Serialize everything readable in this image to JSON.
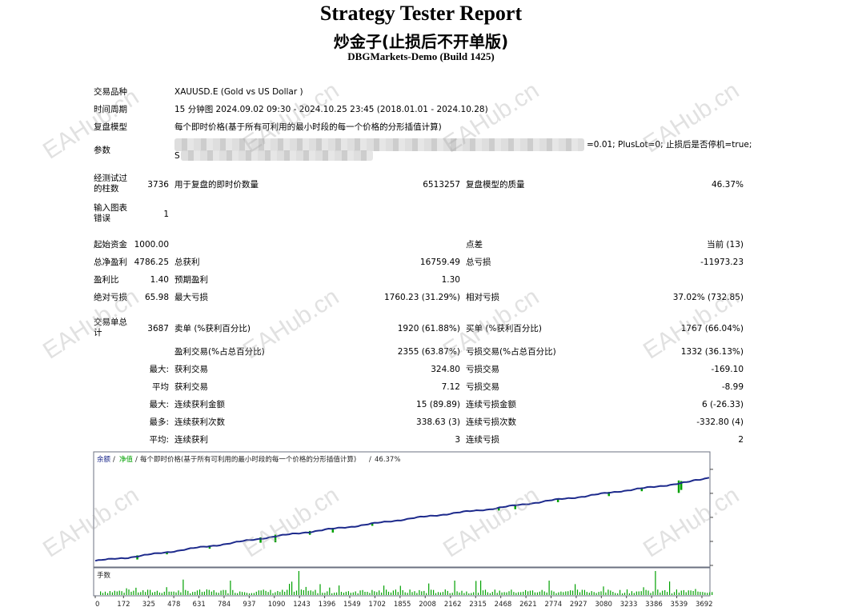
{
  "header": {
    "title": "Strategy Tester Report",
    "ea_name": "炒金子(止损后不开单版)",
    "server": "DBGMarkets-Demo (Build 1425)"
  },
  "settings": {
    "symbol_label": "交易品种",
    "symbol_value": "XAUUSD.E (Gold vs US Dollar )",
    "period_label": "时间周期",
    "period_value": "15 分钟图 2024.09.02 09:30 - 2024.10.25 23:45 (2018.01.01 - 2024.10.28)",
    "model_label": "复盘模型",
    "model_value": "每个即时价格(基于所有可利用的最小时段的每一个价格的分形插值计算)",
    "params_label": "参数",
    "params_visible_1": "=0.01; PlusLot=0; 止损后是否停机=true;",
    "params_visible_2": "S"
  },
  "stats": {
    "bars_label": "经测试过的柱数",
    "bars_value": "3736",
    "ticks_label": "用于复盘的即时价数量",
    "ticks_value": "6513257",
    "quality_label": "复盘模型的质量",
    "quality_value": "46.37%",
    "errors_label": "输入图表错误",
    "errors_value": "1",
    "deposit_label": "起始资金",
    "deposit_value": "1000.00",
    "spread_label": "点差",
    "spread_value": "当前 (13)",
    "net_label": "总净盈利",
    "net_value": "4786.25",
    "gross_profit_label": "总获利",
    "gross_profit_value": "16759.49",
    "gross_loss_label": "总亏损",
    "gross_loss_value": "-11973.23",
    "pf_label": "盈利比",
    "pf_value": "1.40",
    "payoff_label": "预期盈利",
    "payoff_value": "1.30",
    "abs_dd_label": "绝对亏损",
    "abs_dd_value": "65.98",
    "max_dd_label": "最大亏损",
    "max_dd_value": "1760.23 (31.29%)",
    "rel_dd_label": "相对亏损",
    "rel_dd_value": "37.02% (732.85)",
    "trades_label": "交易单总计",
    "trades_value": "3687",
    "short_label": "卖单 (%获利百分比)",
    "short_value": "1920 (61.88%)",
    "long_label": "买单 (%获利百分比)",
    "long_value": "1767 (66.04%)",
    "profit_trades_label": "盈利交易(%占总百分比)",
    "profit_trades_value": "2355 (63.87%)",
    "loss_trades_label": "亏损交易(%占总百分比)",
    "loss_trades_value": "1332 (36.13%)",
    "largest_label": "最大:",
    "largest_profit_label": "获利交易",
    "largest_profit_value": "324.80",
    "largest_loss_label": "亏损交易",
    "largest_loss_value": "-169.10",
    "average_label": "平均",
    "average_profit_label": "获利交易",
    "average_profit_value": "7.12",
    "average_loss_label": "亏损交易",
    "average_loss_value": "-8.99",
    "max_label": "最大:",
    "max_consec_wins_label": "连续获利金额",
    "max_consec_wins_value": "15 (89.89)",
    "max_consec_losses_label": "连续亏损金额",
    "max_consec_losses_value": "6 (-26.33)",
    "maximal_label": "最多:",
    "maximal_profit_label": "连续获利次数",
    "maximal_profit_value": "338.63 (3)",
    "maximal_loss_label": "连续亏损次数",
    "maximal_loss_value": "-332.80 (4)",
    "avg_consec_label": "平均:",
    "avg_consec_wins_label": "连续获利",
    "avg_consec_wins_value": "3",
    "avg_consec_losses_label": "连续亏损",
    "avg_consec_losses_value": "2"
  },
  "watermark": "EAHub.cn",
  "chart_data": {
    "type": "line",
    "legend": [
      "余额",
      "净值",
      "每个即时价格(基于所有可利用的最小时段的每一个价格的分形插值计算)",
      "46.37%"
    ],
    "volume_label": "手数",
    "x_ticks": [
      0,
      172,
      325,
      478,
      631,
      784,
      937,
      1090,
      1243,
      1396,
      1549,
      1702,
      1855,
      2008,
      2162,
      2315,
      2468,
      2621,
      2774,
      2927,
      3080,
      3233,
      3386,
      3539,
      3692
    ],
    "y_ticks": [
      5953,
      4653,
      3352,
      2051,
      751
    ],
    "xlim": [
      0,
      3736
    ],
    "ylim": [
      751,
      6250
    ],
    "balance": [
      [
        0,
        1000
      ],
      [
        200,
        1180
      ],
      [
        400,
        1420
      ],
      [
        600,
        1680
      ],
      [
        800,
        1920
      ],
      [
        1000,
        2200
      ],
      [
        1200,
        2450
      ],
      [
        1400,
        2680
      ],
      [
        1600,
        2900
      ],
      [
        1800,
        3150
      ],
      [
        2000,
        3380
      ],
      [
        2200,
        3600
      ],
      [
        2400,
        3800
      ],
      [
        2600,
        4050
      ],
      [
        2800,
        4300
      ],
      [
        3000,
        4520
      ],
      [
        3200,
        4780
      ],
      [
        3400,
        5000
      ],
      [
        3600,
        5250
      ],
      [
        3736,
        5500
      ]
    ],
    "color_balance": "#1d2a8c",
    "color_equity": "#00a000"
  }
}
